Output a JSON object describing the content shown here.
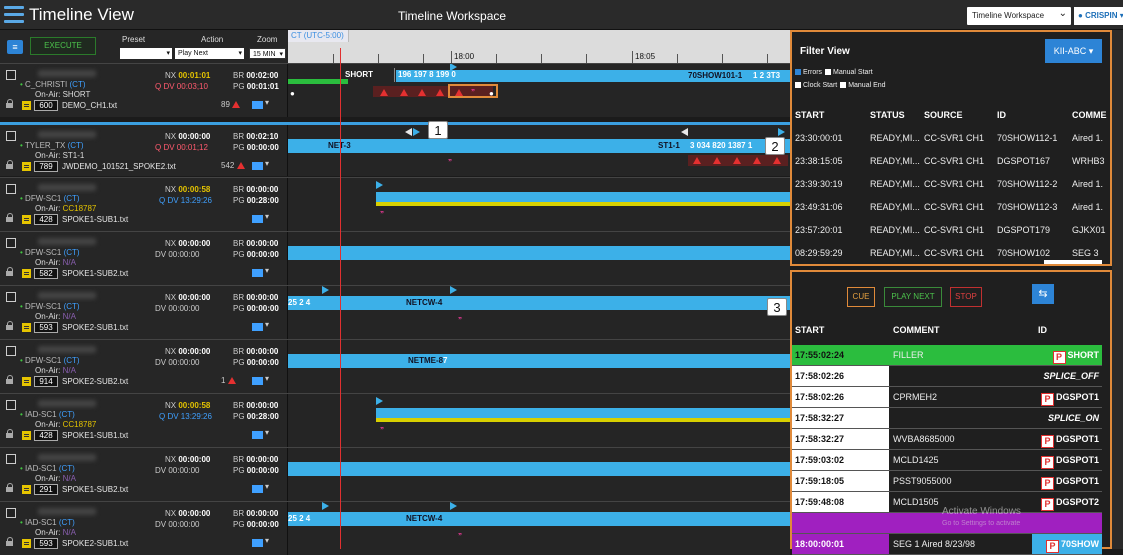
{
  "app": {
    "title": "Timeline View",
    "workspace_title": "Timeline Workspace",
    "workspace_select": "Timeline Workspace",
    "user": "CRISPIN"
  },
  "controls": {
    "execute": "EXECUTE",
    "preset_label": "Preset",
    "action_label": "Action",
    "zoom_label": "Zoom",
    "action_value": "Play Next",
    "zoom_value": "15 MIN"
  },
  "ruler": {
    "timezone": "CT (UTC-5:00)",
    "t1": "18:00",
    "t2": "18:05"
  },
  "rows": [
    {
      "device": "C_CHRISTI",
      "tz": "(CT)",
      "onair_label": "On-Air:",
      "onair": "SHORT",
      "num": "600",
      "file": "DEMO_CH1.txt",
      "nx": "00:01:01",
      "br": "00:02:00",
      "dv": "00:03;10",
      "pg": "00:01:01",
      "errors": "89"
    },
    {
      "device": "TYLER_TX",
      "tz": "(CT)",
      "onair_label": "On-Air:",
      "onair": "ST1-1",
      "num": "789",
      "file": "JWDEMO_101521_SPOKE2.txt",
      "nx": "00:00:00",
      "br": "00:02:10",
      "dv": "00:01;12",
      "pg": "00:00:00",
      "errors": "542"
    },
    {
      "device": "DFW-SC1",
      "tz": "(CT)",
      "onair_label": "On-Air:",
      "onair": "CC18787",
      "num": "428",
      "file": "SPOKE1-SUB1.txt",
      "nx": "00:00:58",
      "br": "00:00:00",
      "dv": "13:29:26",
      "pg": "00:28:00",
      "errors": ""
    },
    {
      "device": "DFW-SC1",
      "tz": "(CT)",
      "onair_label": "On-Air:",
      "onair": "N/A",
      "num": "582",
      "file": "SPOKE1-SUB2.txt",
      "nx": "00:00:00",
      "br": "00:00:00",
      "dv": "00:00:00",
      "pg": "00:00:00",
      "errors": ""
    },
    {
      "device": "DFW-SC1",
      "tz": "(CT)",
      "onair_label": "On-Air:",
      "onair": "N/A",
      "num": "593",
      "file": "SPOKE2-SUB1.txt",
      "nx": "00:00:00",
      "br": "00:00:00",
      "dv": "00:00:00",
      "pg": "00:00:00",
      "errors": ""
    },
    {
      "device": "DFW-SC1",
      "tz": "(CT)",
      "onair_label": "On-Air:",
      "onair": "N/A",
      "num": "914",
      "file": "SPOKE2-SUB2.txt",
      "nx": "00:00:00",
      "br": "00:00:00",
      "dv": "00:00:00",
      "pg": "00:00:00",
      "errors": "1"
    },
    {
      "device": "IAD-SC1",
      "tz": "(CT)",
      "onair_label": "On-Air:",
      "onair": "CC18787",
      "num": "428",
      "file": "SPOKE1-SUB1.txt",
      "nx": "00:00:58",
      "br": "00:00:00",
      "dv": "13:29:26",
      "pg": "00:28:00",
      "errors": ""
    },
    {
      "device": "IAD-SC1",
      "tz": "(CT)",
      "onair_label": "On-Air:",
      "onair": "N/A",
      "num": "291",
      "file": "SPOKE1-SUB2.txt",
      "nx": "00:00:00",
      "br": "00:00:00",
      "dv": "00:00:00",
      "pg": "00:00:00",
      "errors": ""
    },
    {
      "device": "IAD-SC1",
      "tz": "(CT)",
      "onair_label": "On-Air:",
      "onair": "N/A",
      "num": "593",
      "file": "SPOKE2-SUB1.txt",
      "nx": "00:00:00",
      "br": "00:00:00",
      "dv": "00:00:00",
      "pg": "00:00:00",
      "errors": ""
    }
  ],
  "lanes": {
    "r0_short": "SHORT",
    "r0_nums": "196  197  8  199  0",
    "r0_prog": "70SHOW101-1",
    "r0_tail": "1 2 3T3",
    "r1_net": "NET-3",
    "r1_st": "ST1-1",
    "r1_nums": "3 034  820  1387  1",
    "r4_lead": "25  2  4",
    "r4_net": "NETCW-4",
    "r5_net": "NETME-8",
    "r5_seven": "7",
    "r8_lead": "25  2  4",
    "r8_net": "NETCW-4"
  },
  "callouts": {
    "c1": "1",
    "c2": "2",
    "c3": "3"
  },
  "filter": {
    "title": "Filter View",
    "selector": "KII-ABC",
    "errors": "Errors",
    "manual_start": "Manual Start",
    "clock_start": "Clock Start",
    "manual_end": "Manual End",
    "headers": [
      "START",
      "STATUS",
      "SOURCE",
      "ID",
      "COMME"
    ],
    "rows": [
      [
        "23:30:00:01",
        "READY,MI...",
        "CC-SVR1 CH1",
        "70SHOW112-1",
        "Aired 1."
      ],
      [
        "23:38:15:05",
        "READY,MI...",
        "CC-SVR1 CH1",
        "DGSPOT167",
        "WRHB3"
      ],
      [
        "23:39:30:19",
        "READY,MI...",
        "CC-SVR1 CH1",
        "70SHOW112-2",
        "Aired 1."
      ],
      [
        "23:49:31:06",
        "READY,MI...",
        "CC-SVR1 CH1",
        "70SHOW112-3",
        "Aired 1."
      ],
      [
        "23:57:20:01",
        "READY,MI...",
        "CC-SVR1 CH1",
        "DGSPOT179",
        "GJKX01"
      ],
      [
        "08:29:59:29",
        "READY,MI...",
        "CC-SVR1 CH1",
        "70SHOW102",
        "SEG 3"
      ]
    ]
  },
  "playlist": {
    "cue": "CUE",
    "play_next": "PLAY NEXT",
    "stop": "STOP",
    "headers": [
      "START",
      "COMMENT",
      "ID"
    ],
    "rows": [
      {
        "start": "17:55:02:24",
        "comment": "FILLER",
        "id": "SHORT",
        "p": true
      },
      {
        "start": "17:58:02:26",
        "comment": "",
        "id": "SPLICE_OFF",
        "p": false
      },
      {
        "start": "17:58:02:26",
        "comment": "CPRMEH2",
        "id": "DGSPOT1",
        "p": true
      },
      {
        "start": "17:58:32:27",
        "comment": "",
        "id": "SPLICE_ON",
        "p": false
      },
      {
        "start": "17:58:32:27",
        "comment": "WVBA8685000",
        "id": "DGSPOT1",
        "p": true
      },
      {
        "start": "17:59:03:02",
        "comment": "MCLD1425",
        "id": "DGSPOT1",
        "p": true
      },
      {
        "start": "17:59:18:05",
        "comment": "PSST9055000",
        "id": "DGSPOT1",
        "p": true
      },
      {
        "start": "17:59:48:08",
        "comment": "MCLD1505",
        "id": "DGSPOT2",
        "p": true
      },
      {
        "start": "",
        "comment": "",
        "id": "",
        "p": false
      },
      {
        "start": "18:00:00:01",
        "comment": "SEG 1 Aired 8/23/98",
        "id": "70SHOW",
        "p": true
      }
    ],
    "watermark": "Activate Windows",
    "watermark2": "Go to Settings to activate"
  },
  "colors": {
    "accent": "#3cb0e8",
    "orange": "#e08a3a",
    "green": "#2bbd3e",
    "magenta": "#a020c0"
  }
}
